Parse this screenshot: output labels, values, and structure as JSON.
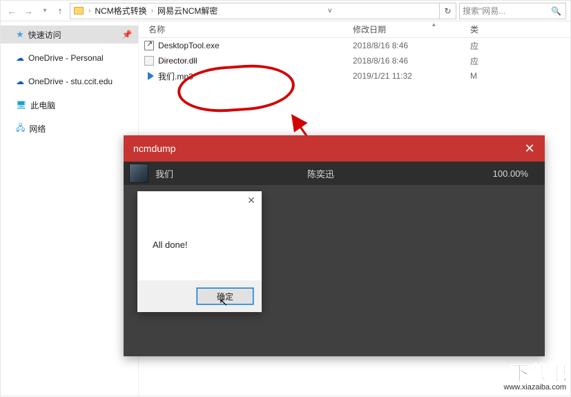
{
  "topbar": {
    "breadcrumb": [
      "NCM格式转换",
      "网易云NCM解密"
    ],
    "search_placeholder": "搜索\"网易...",
    "refresh_hint": "↻"
  },
  "sidebar": {
    "quick_access": "快速访问",
    "onedrive_personal": "OneDrive - Personal",
    "onedrive_school": "OneDrive - stu.ccit.edu",
    "this_pc": "此电脑",
    "network": "网络"
  },
  "columns": {
    "name": "名称",
    "date": "修改日期",
    "type_glimpse": "类"
  },
  "files": [
    {
      "name": "DesktopTool.exe",
      "date": "2018/8/16 8:46",
      "tail": "应"
    },
    {
      "name": "Director.dll",
      "date": "2018/8/16 8:46",
      "tail": "应"
    },
    {
      "name": "我们.mp3",
      "date": "2019/1/21 11:32",
      "tail": "M"
    }
  ],
  "ncmdump": {
    "title": "ncmdump",
    "song": "我们",
    "artist": "陈奕迅",
    "progress": "100.00%"
  },
  "dialog": {
    "message": "All done!",
    "ok_label": "确定"
  },
  "watermark": {
    "logo": "下载吧",
    "url": "www.xiazaiba.com"
  }
}
